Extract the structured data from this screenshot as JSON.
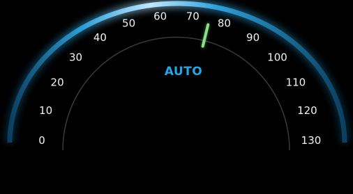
{
  "speedometer": {
    "mode_label": "AUTO",
    "scale": [
      "0",
      "10",
      "20",
      "30",
      "40",
      "50",
      "60",
      "70",
      "80",
      "90",
      "100",
      "110",
      "120",
      "130"
    ],
    "min": 0,
    "max": 130,
    "needle_value": 75.5
  },
  "colors": {
    "background": "#000000",
    "arc_bright": "#bfe8ff",
    "arc_mid": "#2d9fd8",
    "arc_dark": "#0b3f5e",
    "inner_track": "#3a3a3a",
    "needle": "#8be08a",
    "mode_label": "#1fa8e8",
    "tick_text": "#f2f2f2"
  }
}
